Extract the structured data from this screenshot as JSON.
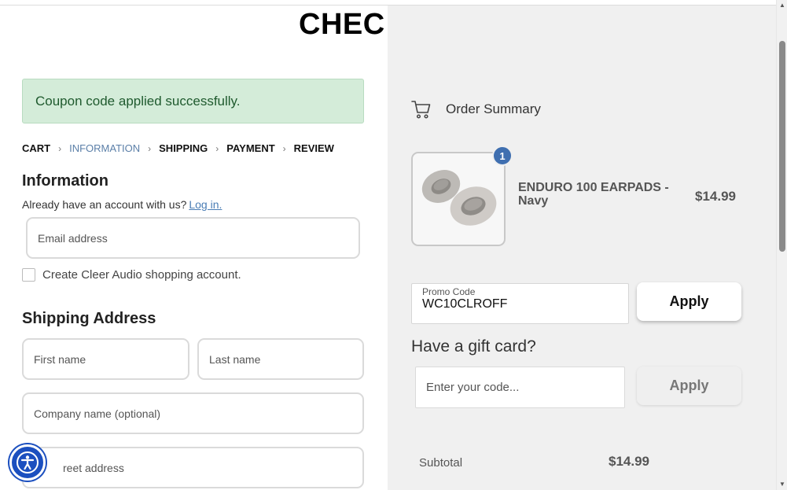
{
  "header": {
    "title": "CHEC"
  },
  "alert": {
    "text": "Coupon code applied successfully."
  },
  "breadcrumb": [
    {
      "label": "CART",
      "active": false
    },
    {
      "label": "INFORMATION",
      "active": true
    },
    {
      "label": "SHIPPING",
      "active": false
    },
    {
      "label": "PAYMENT",
      "active": false
    },
    {
      "label": "REVIEW",
      "active": false
    }
  ],
  "information": {
    "heading": "Information",
    "account_prompt": "Already have an account with us?",
    "login_link": "Log in.",
    "email_placeholder": "Email address",
    "create_account_label": "Create Cleer Audio shopping account."
  },
  "shipping": {
    "heading": "Shipping Address",
    "first_name_placeholder": "First name",
    "last_name_placeholder": "Last name",
    "company_placeholder": "Company name (optional)",
    "street_placeholder": "reet address"
  },
  "order_summary": {
    "heading": "Order Summary",
    "item": {
      "name": "ENDURO 100 EARPADS - Navy",
      "price": "$14.99",
      "quantity": "1"
    },
    "promo": {
      "label": "Promo Code",
      "value": "WC10CLROFF",
      "apply_label": "Apply"
    },
    "gift_card": {
      "heading": "Have a gift card?",
      "placeholder": "Enter your code...",
      "apply_label": "Apply"
    },
    "subtotal": {
      "label": "Subtotal",
      "value": "$14.99"
    }
  },
  "colors": {
    "accent": "#5b7fa8",
    "badge": "#3f6fb0",
    "success_bg": "#d4ecd9",
    "accessibility": "#1b4fbf"
  },
  "icons": [
    "cart-icon",
    "chevron-right-icon",
    "accessibility-icon"
  ]
}
